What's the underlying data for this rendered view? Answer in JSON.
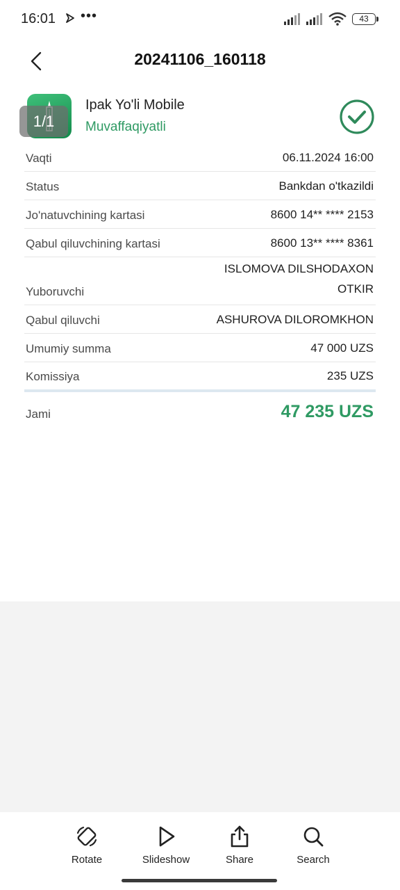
{
  "status_bar": {
    "time": "16:01",
    "dots": "•••",
    "battery": "43",
    "icons": [
      "navigation-icon",
      "signal-icon",
      "signal-icon",
      "wifi-icon",
      "battery-icon"
    ]
  },
  "header": {
    "title": "20241106_160118",
    "back_icon": "chevron-left-icon"
  },
  "viewer": {
    "page_counter": "1/1"
  },
  "receipt": {
    "bank_name": "Ipak Yo'li Mobile",
    "status": "Muvaffaqiyatli",
    "status_color": "#2f9a63",
    "rows": [
      {
        "label": "Vaqti",
        "value": "06.11.2024 16:00"
      },
      {
        "label": "Status",
        "value": "Bankdan o'tkazildi"
      },
      {
        "label": "Jo'natuvchining kartasi",
        "value": "8600 14** **** 2153"
      },
      {
        "label": "Qabul qiluvchining kartasi",
        "value": "8600 13** **** 8361"
      },
      {
        "label": "Yuboruvchi",
        "value_line1": "ISLOMOVA DILSHODAXON",
        "value_line2": "OTKIR"
      },
      {
        "label": "Qabul qiluvchi",
        "value": "ASHUROVA DILOROMKHON"
      },
      {
        "label": "Umumiy summa",
        "value": "47 000 UZS"
      },
      {
        "label": "Komissiya",
        "value": "235 UZS"
      }
    ],
    "total": {
      "label": "Jami",
      "value": "47 235 UZS"
    }
  },
  "toolbar": {
    "rotate": "Rotate",
    "slideshow": "Slideshow",
    "share": "Share",
    "search": "Search"
  }
}
